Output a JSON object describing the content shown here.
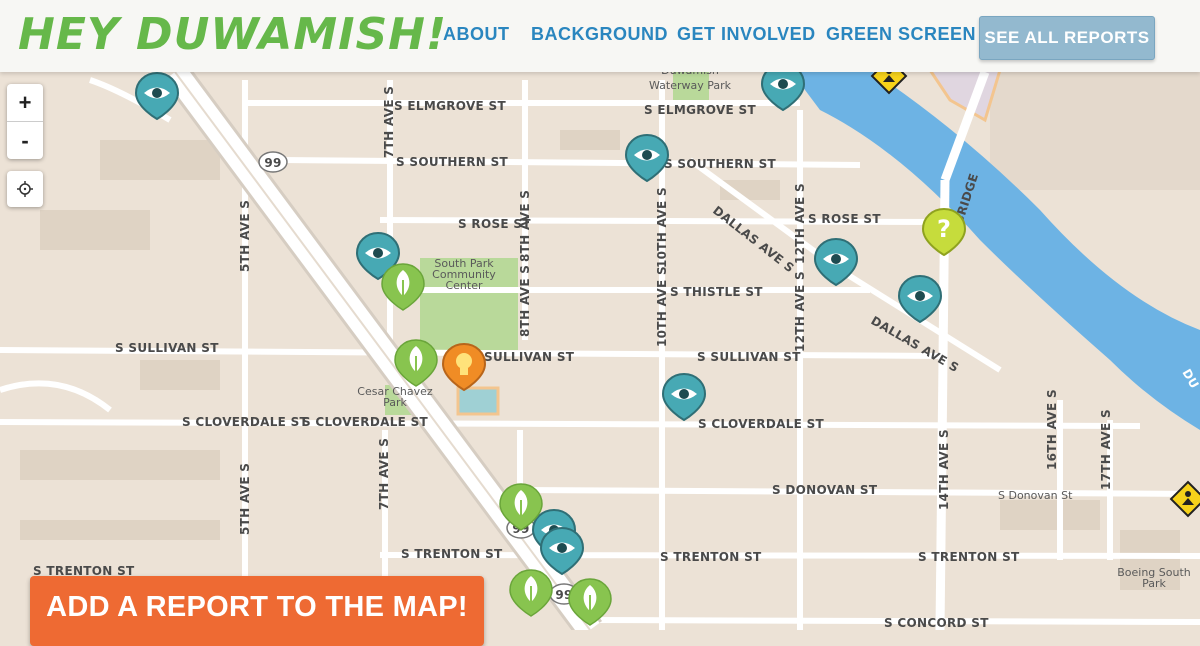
{
  "header": {
    "logo": "HEY DUWAMISH!",
    "nav": [
      {
        "label": "ABOUT"
      },
      {
        "label": "BACKGROUND"
      },
      {
        "label": "GET INVOLVED"
      },
      {
        "label": "GREEN SCREEN"
      }
    ],
    "cta_label": "SEE ALL REPORTS"
  },
  "map_controls": {
    "zoom_in": "+",
    "zoom_out": "-"
  },
  "add_report_label": "ADD A REPORT TO THE MAP!",
  "colors": {
    "land": "#ece2d6",
    "water": "#6db3e4",
    "park": "#b9d99a",
    "eye_marker": "#47a9b4",
    "tree_marker": "#88c44f",
    "idea_marker": "#f08c25",
    "question_marker": "#c6dc3c",
    "logo": "#66b84a",
    "nav": "#2a86bf",
    "add_button": "#ee6a33"
  },
  "labels": {
    "elmgrove": "S ELMGROVE ST",
    "elmgrove2": "S ELMGROVE ST",
    "southern": "S SOUTHERN ST",
    "southern2": "S SOUTHERN ST",
    "rose": "S ROSE ST",
    "rose2": "S ROSE ST",
    "thistle": "S THISTLE ST",
    "sullivan_w": "S SULLIVAN ST",
    "sullivan_mid": "SULLIVAN ST",
    "sullivan_e": "S SULLIVAN ST",
    "cloverdale1": "S CLOVERDALE ST",
    "cloverdale2": "S CLOVERDALE ST",
    "cloverdale3": "S CLOVERDALE ST",
    "donovan": "S DONOVAN ST",
    "donovan2": "S Donovan St",
    "trenton_w": "S TRENTON ST",
    "trenton_mid": "S TRENTON ST",
    "trenton_e1": "S TRENTON ST",
    "trenton_e2": "S TRENTON ST",
    "concord": "S CONCORD ST",
    "ave5_a": "5TH AVE S",
    "ave5_b": "5TH AVE S",
    "ave7_a": "7TH AVE S",
    "ave7_b": "7TH AVE S",
    "ave8": "8TH AVE S",
    "ave8th_a": "8TH AVE S",
    "ave10_a": "10TH AVE S",
    "ave10_b": "10TH AVE S",
    "ave12_a": "12TH AVE S",
    "ave12_b": "12TH AVE S",
    "ave14": "14TH AVE S",
    "ave16": "16TH AVE S",
    "ave17": "17TH AVE S",
    "dallas1": "DALLAS AVE S",
    "dallas2": "DALLAS AVE S",
    "bridge": "BRIDGE",
    "river": "DU",
    "hwy99_1": "99",
    "hwy99_2": "99",
    "hwy99_3": "99",
    "south_park_cc_1": "South Park",
    "south_park_cc_2": "Community",
    "south_park_cc_3": "Center",
    "cesar_1": "Cesar Chavez",
    "cesar_2": "Park",
    "waterway_1": "Duwamish",
    "waterway_2": "Waterway Park",
    "boeing_1": "Boeing South",
    "boeing_2": "Park"
  }
}
